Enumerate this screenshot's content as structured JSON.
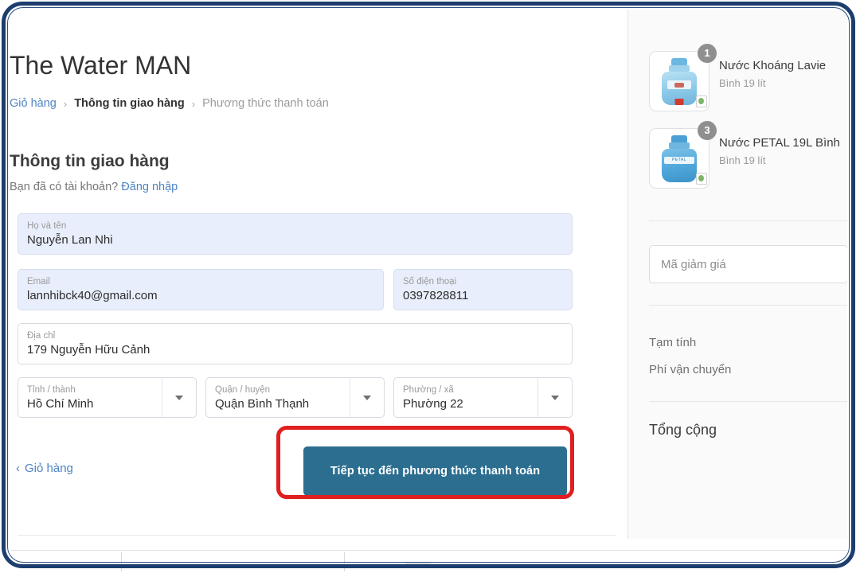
{
  "brand": {
    "title": "The Water MAN"
  },
  "breadcrumb": {
    "items": [
      {
        "label": "Giỏ hàng",
        "state": "link"
      },
      {
        "label": "Thông tin giao hàng",
        "state": "current"
      },
      {
        "label": "Phương thức thanh toán",
        "state": "upcoming"
      }
    ],
    "separator": "›"
  },
  "form": {
    "section_title": "Thông tin giao hàng",
    "account_prompt": "Bạn đã có tài khoản?",
    "login_link": "Đăng nhập",
    "fields": [
      {
        "label": "Họ và tên",
        "value": "Nguyễn Lan Nhi"
      },
      {
        "label": "Email",
        "value": "lannhibck40@gmail.com"
      },
      {
        "label": "Số điện thoại",
        "value": "0397828811"
      },
      {
        "label": "Địa chỉ",
        "value": "179 Nguyễn Hữu Cảnh"
      }
    ],
    "selects": [
      {
        "label": "Tỉnh / thành",
        "value": "Hồ Chí Minh"
      },
      {
        "label": "Quận / huyện",
        "value": "Quận Bình Thạnh"
      },
      {
        "label": "Phường / xã",
        "value": "Phường 22"
      }
    ]
  },
  "actions": {
    "back_chevron": "‹",
    "back_label": "Giỏ hàng",
    "submit_label": "Tiếp tục đến phương thức thanh toán"
  },
  "summary": {
    "cart_items": [
      {
        "name": "Nước Khoáng Lavie",
        "variant": "Bình 19 lít",
        "qty": "1"
      },
      {
        "name": "Nước PETAL 19L Bình",
        "variant": "Bình 19 lít",
        "qty": "3"
      }
    ],
    "discount_placeholder": "Mã giảm giá",
    "rows": [
      {
        "label": "Tạm tính"
      },
      {
        "label": "Phí vận chuyển"
      }
    ],
    "total_label": "Tổng cộng"
  },
  "annotation": {
    "highlight_color": "#e02020",
    "frame_color": "#1c3d6e"
  },
  "theme": {
    "accent": "#2b6e90",
    "link": "#4f83c4",
    "autofill_bg": "#e8eefb",
    "sidebar_bg": "#fafafa"
  }
}
